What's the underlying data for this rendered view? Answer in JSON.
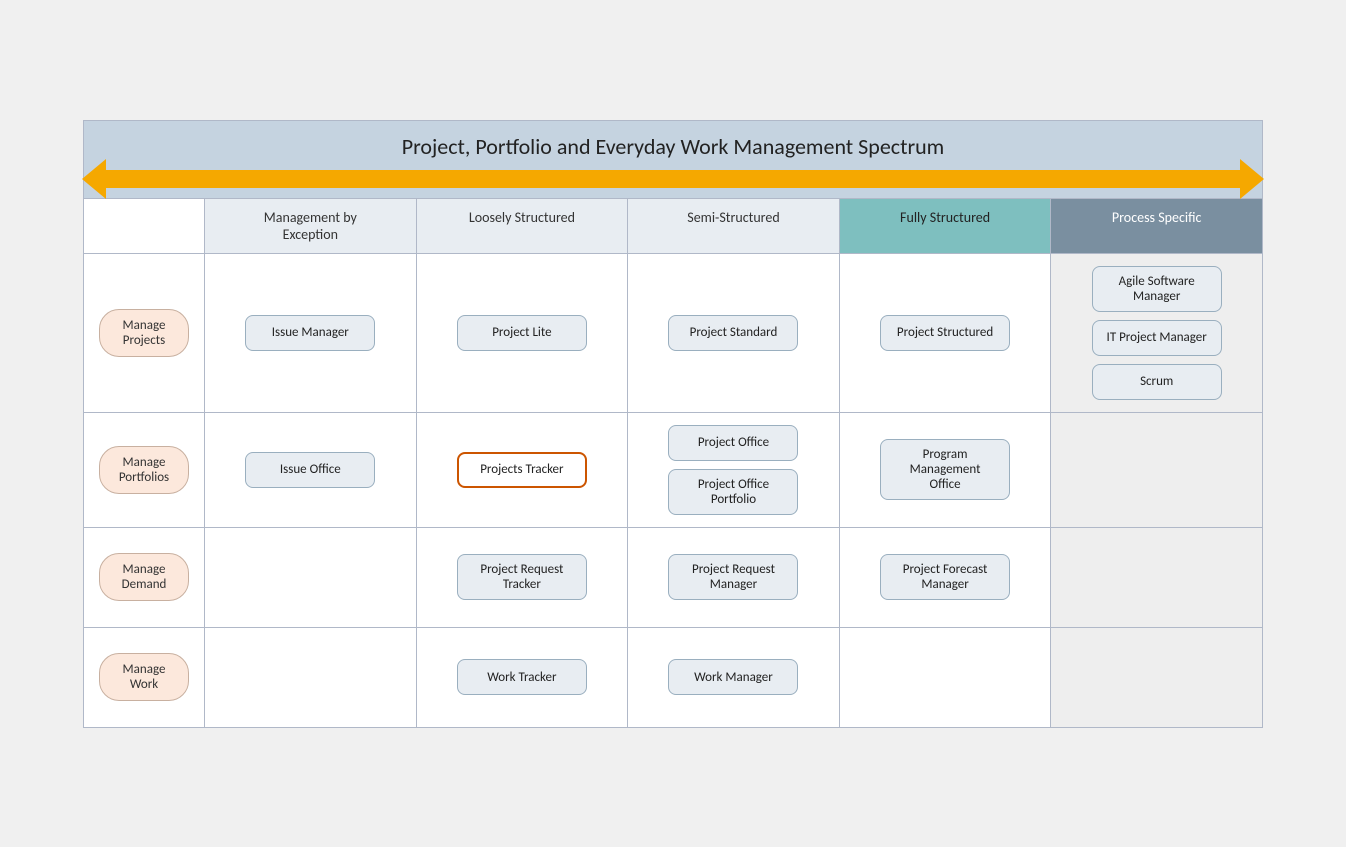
{
  "title": "Project, Portfolio and Everyday Work Management Spectrum",
  "column_headers": [
    {
      "label": "Management by\nException",
      "style": "normal"
    },
    {
      "label": "Loosely Structured",
      "style": "normal"
    },
    {
      "label": "Semi-Structured",
      "style": "normal"
    },
    {
      "label": "Fully Structured",
      "style": "teal"
    },
    {
      "label": "Process Specific",
      "style": "dark"
    }
  ],
  "rows": [
    {
      "label": "Manage\nProjects",
      "cells": [
        {
          "items": [
            "Issue Manager"
          ]
        },
        {
          "items": [
            "Project Lite"
          ]
        },
        {
          "items": [
            "Project Standard"
          ]
        },
        {
          "items": [
            "Project Structured"
          ]
        },
        {
          "items": [
            "Agile Software\nManager",
            "IT Project Manager",
            "Scrum"
          ],
          "style": "process-specific"
        }
      ]
    },
    {
      "label": "Manage\nPortfolios",
      "cells": [
        {
          "items": [
            "Issue Office"
          ]
        },
        {
          "items": [
            "Projects Tracker"
          ],
          "highlighted": [
            0
          ]
        },
        {
          "items": [
            "Project Office",
            "Project Office\nPortfolio"
          ]
        },
        {
          "items": [
            "Program\nManagement\nOffice"
          ]
        },
        {
          "items": [],
          "style": "process-specific"
        }
      ]
    },
    {
      "label": "Manage\nDemand",
      "cells": [
        {
          "items": []
        },
        {
          "items": [
            "Project Request\nTracker"
          ]
        },
        {
          "items": [
            "Project Request\nManager"
          ]
        },
        {
          "items": [
            "Project Forecast\nManager"
          ]
        },
        {
          "items": [],
          "style": "process-specific"
        }
      ]
    },
    {
      "label": "Manage\nWork",
      "cells": [
        {
          "items": []
        },
        {
          "items": [
            "Work Tracker"
          ]
        },
        {
          "items": [
            "Work Manager"
          ]
        },
        {
          "items": []
        },
        {
          "items": [],
          "style": "process-specific"
        }
      ]
    }
  ]
}
